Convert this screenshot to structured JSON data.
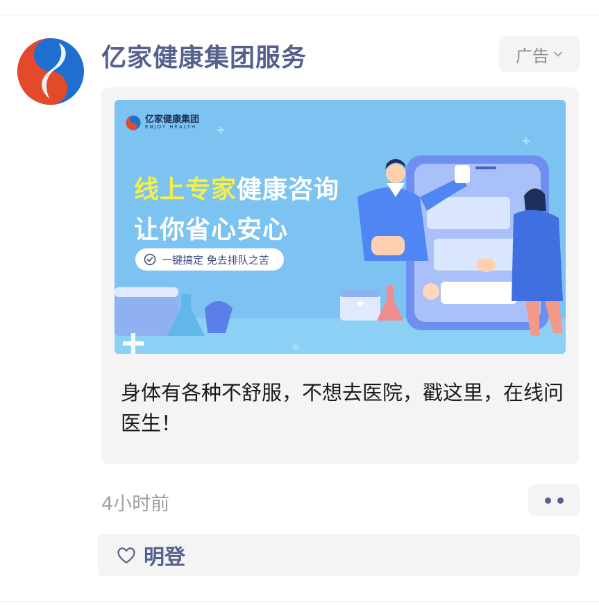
{
  "post": {
    "author": "亿家健康集团服务",
    "ad_label": "广告",
    "banner": {
      "brand_cn": "亿家健康集团",
      "brand_en": "ENJOY HEALTH",
      "headline_highlight": "线上专家",
      "headline_rest": "健康咨询",
      "headline_line2": "让你省心安心",
      "pill_text": "一键搞定 免去排队之苦"
    },
    "caption": "身体有各种不舒服，不想去医院，戳这里，在线问医生！",
    "time": "4小时前",
    "likes": [
      "明登"
    ]
  },
  "colors": {
    "name_blue": "#55608d",
    "banner_blue": "#7cc3f1",
    "headline_yellow": "#f5ef4a"
  },
  "icons": [
    "yin-yang-logo-icon",
    "chevron-down-icon",
    "check-circle-icon",
    "heart-outline-icon",
    "more-dots-icon"
  ]
}
